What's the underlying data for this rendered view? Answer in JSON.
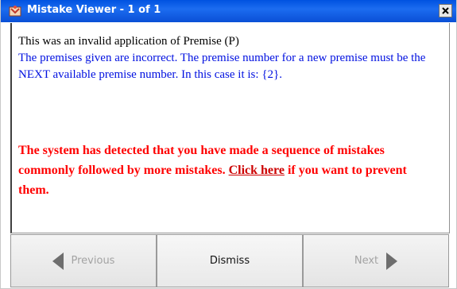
{
  "window": {
    "title": "Mistake Viewer - 1 of 1",
    "close_label": "X"
  },
  "message": {
    "line_black": "This was an invalid application of Premise (P)",
    "blue_text": "The premises given are incorrect. The premise number for a new premise must be the NEXT available premise number. In this case it is: {2}.",
    "red_before_link": "The system has detected that you have made a sequence of mistakes commonly followed by more mistakes. ",
    "link_text": "Click here",
    "red_after_link": " if you want to prevent them."
  },
  "buttons": {
    "previous_label": "Previous",
    "dismiss_label": "Dismiss",
    "next_label": "Next"
  },
  "colors": {
    "titlebar": "#0a4fd6",
    "black_text": "#000000",
    "blue_text": "#0010e0",
    "red_text": "#ff0000"
  },
  "icons": {
    "app": "mistake-viewer-icon",
    "close": "close-icon",
    "previous": "arrow-left-icon",
    "next": "arrow-right-icon"
  }
}
